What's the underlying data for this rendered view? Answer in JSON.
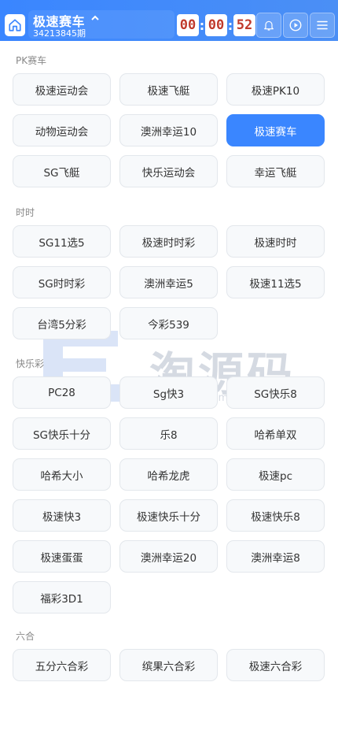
{
  "header": {
    "title": "极速赛车",
    "issue": "34213845期",
    "timer": [
      "00",
      "00",
      "52"
    ],
    "icons": [
      "home-icon",
      "chevron-up-icon",
      "bell-icon",
      "play-circle-icon",
      "menu-icon"
    ]
  },
  "sections": [
    {
      "title": "PK赛车",
      "items": [
        "极速运动会",
        "极速飞艇",
        "极速PK10",
        "动物运动会",
        "澳洲幸运10",
        "极速赛车",
        "SG飞艇",
        "快乐运动会",
        "幸运飞艇"
      ],
      "active": "极速赛车"
    },
    {
      "title": "时时",
      "items": [
        "SG11选5",
        "极速时时彩",
        "极速时时",
        "SG时时彩",
        "澳洲幸运5",
        "极速11选5",
        "台湾5分彩",
        "今彩539"
      ]
    },
    {
      "title": "快乐彩",
      "items": [
        "PC28",
        "Sg快3",
        "SG快乐8",
        "SG快乐十分",
        "乐8",
        "哈希单双",
        "哈希大小",
        "哈希龙虎",
        "极速pc",
        "极速快3",
        "极速快乐十分",
        "极速快乐8",
        "极速蛋蛋",
        "澳洲幸运20",
        "澳洲幸运8",
        "福彩3D1"
      ]
    },
    {
      "title": "六合",
      "items": [
        "五分六合彩",
        "缤果六合彩",
        "极速六合彩"
      ]
    }
  ],
  "watermark": {
    "text": "淘源码",
    "url": "www.taoymw.com"
  },
  "colors": {
    "header_bg": "#3a86ff",
    "active_item": "#3a86ff",
    "timer_digits": "#c0392b"
  }
}
